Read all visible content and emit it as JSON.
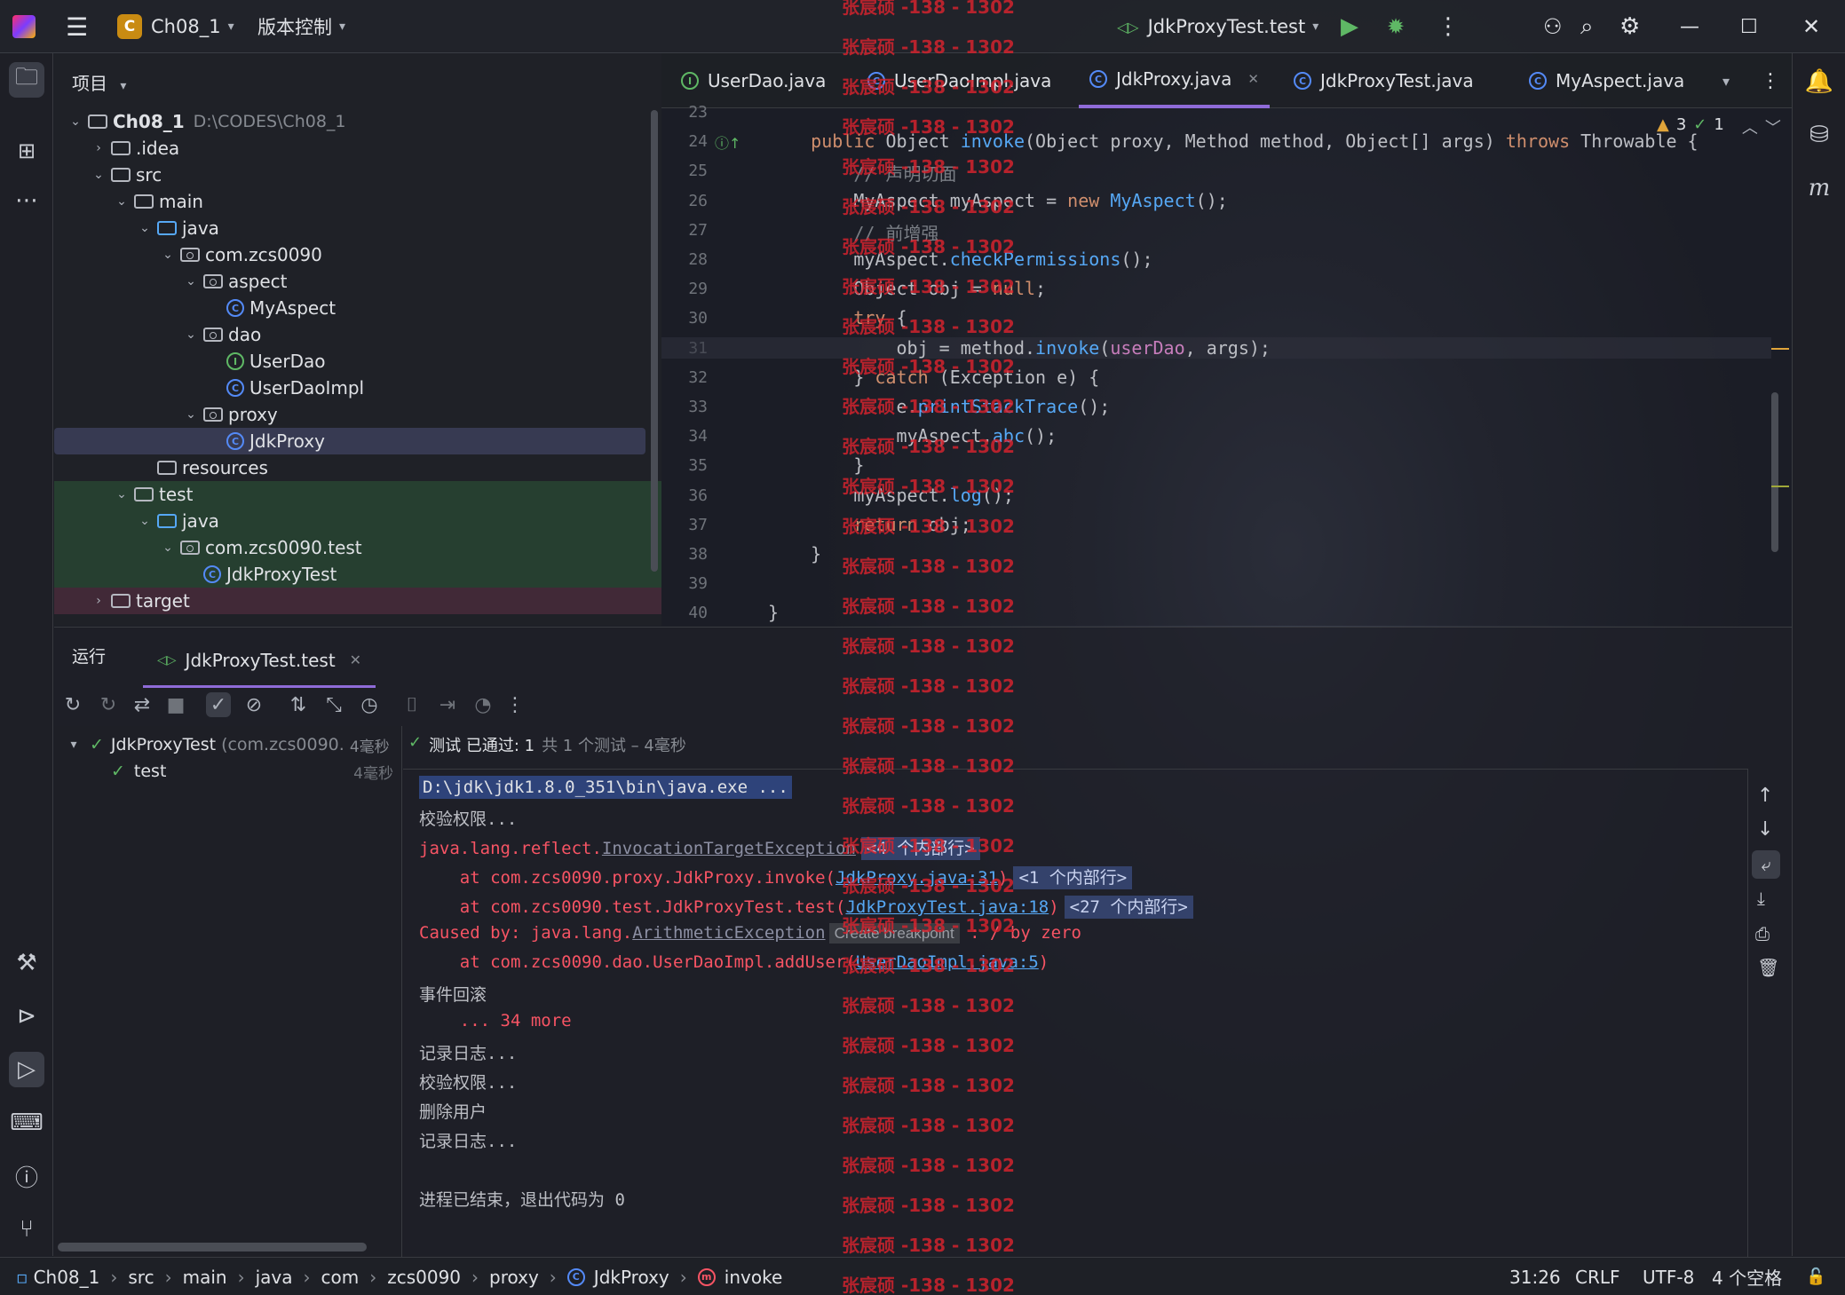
{
  "titlebar": {
    "project_badge": "C",
    "project_name": "Ch08_1",
    "vcs_label": "版本控制",
    "run_config": "JdkProxyTest.test"
  },
  "project_panel": {
    "title": "项目",
    "tree": [
      {
        "label": "Ch08_1",
        "extra": "D:\\CODES\\Ch08_1",
        "icon": "folder",
        "depth": 0,
        "arrow": "down"
      },
      {
        "label": ".idea",
        "icon": "folder",
        "depth": 1,
        "arrow": "right"
      },
      {
        "label": "src",
        "icon": "folder",
        "depth": 1,
        "arrow": "down"
      },
      {
        "label": "main",
        "icon": "folder",
        "depth": 2,
        "arrow": "down"
      },
      {
        "label": "java",
        "icon": "folder-blue",
        "depth": 3,
        "arrow": "down"
      },
      {
        "label": "com.zcs0090",
        "icon": "package",
        "depth": 4,
        "arrow": "down"
      },
      {
        "label": "aspect",
        "icon": "package",
        "depth": 5,
        "arrow": "down"
      },
      {
        "label": "MyAspect",
        "icon": "class",
        "depth": 6,
        "arrow": ""
      },
      {
        "label": "dao",
        "icon": "package",
        "depth": 5,
        "arrow": "down"
      },
      {
        "label": "UserDao",
        "icon": "interface",
        "depth": 6,
        "arrow": ""
      },
      {
        "label": "UserDaoImpl",
        "icon": "class",
        "depth": 6,
        "arrow": ""
      },
      {
        "label": "proxy",
        "icon": "package",
        "depth": 5,
        "arrow": "down"
      },
      {
        "label": "JdkProxy",
        "icon": "class",
        "depth": 6,
        "arrow": ""
      },
      {
        "label": "resources",
        "icon": "folder",
        "depth": 3,
        "arrow": ""
      },
      {
        "label": "test",
        "icon": "folder",
        "depth": 2,
        "arrow": "down"
      },
      {
        "label": "java",
        "icon": "folder-blue",
        "depth": 3,
        "arrow": "down"
      },
      {
        "label": "com.zcs0090.test",
        "icon": "package",
        "depth": 4,
        "arrow": "down"
      },
      {
        "label": "JdkProxyTest",
        "icon": "class",
        "depth": 5,
        "arrow": ""
      },
      {
        "label": "target",
        "icon": "folder",
        "depth": 1,
        "arrow": "right"
      }
    ]
  },
  "editor": {
    "tabs": [
      {
        "label": "UserDao.java",
        "icon": "interface"
      },
      {
        "label": "UserDaoImpl.java",
        "icon": "class"
      },
      {
        "label": "JdkProxy.java",
        "icon": "class",
        "selected": true
      },
      {
        "label": "JdkProxyTest.java",
        "icon": "class"
      },
      {
        "label": "MyAspect.java",
        "icon": "class"
      }
    ],
    "inspection": {
      "warnings": "3",
      "ok": "1"
    },
    "lines": [
      {
        "num": "23",
        "code": ""
      },
      {
        "num": "24",
        "code": "    public Object invoke(Object proxy, Method method, Object[] args) throws Throwable {"
      },
      {
        "num": "25",
        "code": "        // 声明切面"
      },
      {
        "num": "26",
        "code": "        MyAspect myAspect = new MyAspect();"
      },
      {
        "num": "27",
        "code": "        // 前增强"
      },
      {
        "num": "28",
        "code": "        myAspect.checkPermissions();"
      },
      {
        "num": "29",
        "code": "        Object obj = null;"
      },
      {
        "num": "30",
        "code": "        try {"
      },
      {
        "num": "31",
        "code": "            obj = method.invoke(userDao, args);"
      },
      {
        "num": "32",
        "code": "        } catch (Exception e) {"
      },
      {
        "num": "33",
        "code": "            e.printStackTrace();"
      },
      {
        "num": "34",
        "code": "            myAspect.abc();"
      },
      {
        "num": "35",
        "code": "        }"
      },
      {
        "num": "36",
        "code": "        myAspect.log();"
      },
      {
        "num": "37",
        "code": "        return obj;"
      },
      {
        "num": "38",
        "code": "    }"
      },
      {
        "num": "39",
        "code": ""
      },
      {
        "num": "40",
        "code": "}"
      }
    ]
  },
  "run_panel": {
    "title": "运行",
    "tab_label": "JdkProxyTest.test",
    "status": "测试 已通过: 1",
    "status_detail": "共 1 个测试 – 4毫秒",
    "tree": [
      {
        "label": "JdkProxyTest",
        "extra": "(com.zcs0090.",
        "time": "4毫秒"
      },
      {
        "label": "test",
        "time": "4毫秒"
      }
    ],
    "console": {
      "cmd": "D:\\jdk\\jdk1.8.0_351\\bin\\java.exe ...",
      "l1": "校验权限...",
      "l2_prefix": "java.lang.reflect.",
      "l2_link": "InvocationTargetException",
      "l2_fold": "<4 个内部行>",
      "l3_prefix": "    at com.zcs0090.proxy.JdkProxy.invoke(",
      "l3_link": "JdkProxy.java:31",
      "l3_suffix": ")",
      "l3_fold": "<1 个内部行>",
      "l4_prefix": "    at com.zcs0090.test.JdkProxyTest.test(",
      "l4_link": "JdkProxyTest.java:18",
      "l4_suffix": ")",
      "l4_fold": "<27 个内部行>",
      "l5_prefix": "Caused by: java.lang.",
      "l5_link": "ArithmeticException",
      "l5_tooltip": "Create breakpoint",
      "l5_suffix": " : / by zero",
      "l6_prefix": "    at com.zcs0090.dao.UserDaoImpl.addUser(",
      "l6_link": "UserDaoImpl.java:5",
      "l6_suffix": ")",
      "l7": "事件回滚",
      "l8": "    ... 34 more",
      "l9": "记录日志...",
      "l10": "校验权限...",
      "l11": "删除用户",
      "l12": "记录日志...",
      "l13": "进程已结束，退出代码为 0"
    }
  },
  "statusbar": {
    "breadcrumb": [
      "Ch08_1",
      "src",
      "main",
      "java",
      "com",
      "zcs0090",
      "proxy",
      "JdkProxy",
      "invoke"
    ],
    "position": "31:26",
    "line_sep": "CRLF",
    "encoding": "UTF-8",
    "indent": "4 个空格"
  },
  "watermark": "张宸硕 -138 - 1302",
  "colors": {
    "accent": "#8f6bd8",
    "error": "#f75464",
    "link": "#56a8f5",
    "keyword": "#cf8e6d",
    "watermark": "#d9232e"
  }
}
